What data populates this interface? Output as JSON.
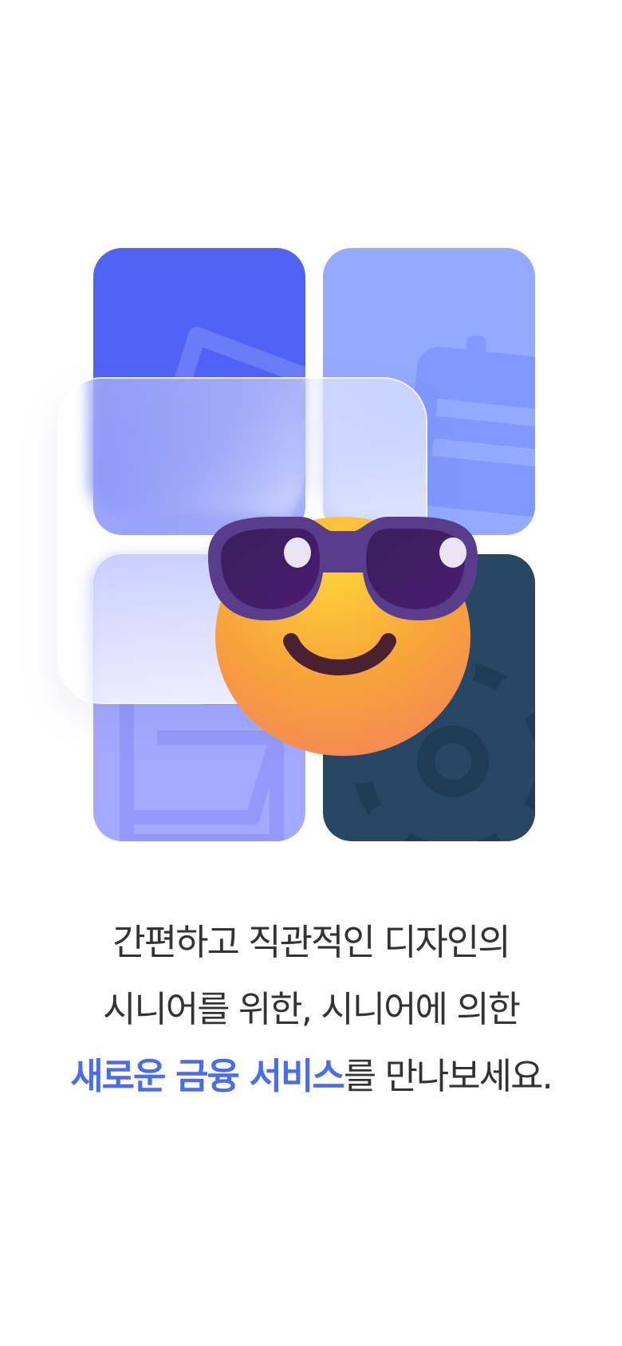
{
  "intro": {
    "line1": "간편하고 직관적인 디자인의",
    "line2": "시니어를 위한, 시니어에 의한",
    "line3_highlight": "새로운 금융 서비스",
    "line3_rest": "를 만나보세요."
  },
  "illustration": {
    "tiles": [
      {
        "name": "tile-card",
        "color": "#5163f5",
        "icon": "card-icon"
      },
      {
        "name": "tile-calendar",
        "color": "#93aaff",
        "icon": "calendar-icon"
      },
      {
        "name": "tile-folder",
        "color": "#a3a9ff",
        "icon": "folder-icon"
      },
      {
        "name": "tile-settings",
        "color": "#274763",
        "icon": "gear-icon"
      }
    ],
    "emoji": "smiling-face-with-sunglasses-icon"
  },
  "colors": {
    "accent": "#4a6cf0",
    "text": "#333333",
    "background": "#ffffff"
  }
}
